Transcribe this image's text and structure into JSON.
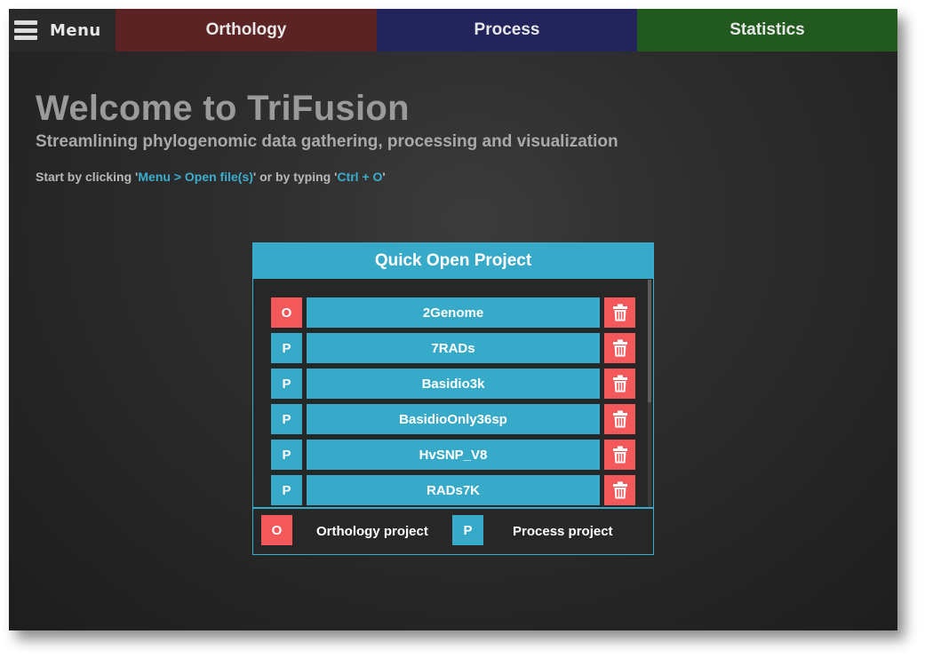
{
  "menu": {
    "label": "Menu"
  },
  "tabs": [
    {
      "label": "Orthology",
      "color": "#5b2323"
    },
    {
      "label": "Process",
      "color": "#23245c"
    },
    {
      "label": "Statistics",
      "color": "#22591f"
    }
  ],
  "welcome": {
    "title": "Welcome to TriFusion",
    "subtitle": "Streamlining phylogenomic data gathering, processing and visualization",
    "hint_prefix": "Start by clicking '",
    "hint_menu": "Menu > Open file(s)",
    "hint_middle": "' or by typing '",
    "hint_shortcut": "Ctrl + O",
    "hint_suffix": "'"
  },
  "quick_open": {
    "title": "Quick Open Project",
    "projects": [
      {
        "type": "O",
        "name": "2Genome"
      },
      {
        "type": "P",
        "name": "7RADs"
      },
      {
        "type": "P",
        "name": "Basidio3k"
      },
      {
        "type": "P",
        "name": "BasidioOnly36sp"
      },
      {
        "type": "P",
        "name": "HvSNP_V8"
      },
      {
        "type": "P",
        "name": "RADs7K"
      }
    ],
    "legend": {
      "orthology_badge": "O",
      "orthology_label": "Orthology project",
      "process_badge": "P",
      "process_label": "Process project"
    }
  },
  "colors": {
    "accent": "#37a9c9",
    "orthology_red": "#f3585a",
    "highlight": "#3aaed0"
  },
  "icons": {
    "delete": "trash-icon",
    "menu": "hamburger-icon"
  }
}
